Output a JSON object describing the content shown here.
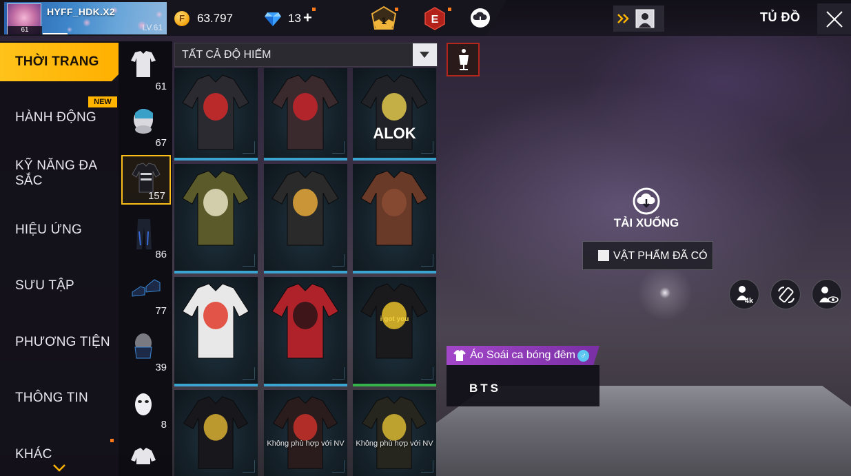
{
  "player": {
    "name": "HYFF_HDK.X2",
    "avatar_level": "61",
    "level_label": "LV.61"
  },
  "currency": {
    "gold_symbol": "F",
    "gold": "63.797",
    "diamonds": "13",
    "add_symbol": "+"
  },
  "top_icons": {
    "rank_badge": "1",
    "elite_badge": "E"
  },
  "header": {
    "title": "TỦ ĐỒ"
  },
  "sidebar": {
    "items": [
      {
        "label": "THỜI TRANG",
        "active": true
      },
      {
        "label": "HÀNH ĐỘNG"
      },
      {
        "label": "KỸ NĂNG ĐA SẮC"
      },
      {
        "label": "HIỆU ỨNG"
      },
      {
        "label": "SƯU TẬP"
      },
      {
        "label": "PHƯƠNG TIỆN"
      },
      {
        "label": "THÔNG TIN"
      },
      {
        "label": "KHÁC"
      }
    ],
    "new_badge": "NEW"
  },
  "categories": [
    {
      "icon": "outfit-icon",
      "count": "61"
    },
    {
      "icon": "headwear-icon",
      "count": "67"
    },
    {
      "icon": "top-icon",
      "count": "157",
      "active": true
    },
    {
      "icon": "pants-icon",
      "count": "86"
    },
    {
      "icon": "shoes-icon",
      "count": "77"
    },
    {
      "icon": "mask-icon",
      "count": "39"
    },
    {
      "icon": "face-mask-icon",
      "count": "8"
    },
    {
      "icon": "jacket-icon",
      "count": ""
    }
  ],
  "filter": {
    "label": "TẤT CẢ ĐỘ HIẾM"
  },
  "items": [
    {
      "name": "wolf-tee",
      "color": "#2a2a30",
      "accent": "#d42a2a",
      "bar": "blue"
    },
    {
      "name": "red-hooded-top",
      "color": "#3a2a2e",
      "accent": "#c8242a",
      "bar": "blue"
    },
    {
      "name": "alok-tee",
      "color": "#202228",
      "accent": "#e0c84a",
      "bar": "blue",
      "print": "ALOK"
    },
    {
      "name": "camo-jacket",
      "color": "#5b5a2a",
      "accent": "#e8e2c2",
      "bar": "blue"
    },
    {
      "name": "varsity-jacket",
      "color": "#2a2a2a",
      "accent": "#e6a83a",
      "bar": "blue"
    },
    {
      "name": "brown-leather-top",
      "color": "#6a3a28",
      "accent": "#8a4c34",
      "bar": "blue"
    },
    {
      "name": "egg-tee",
      "color": "#e8e8e8",
      "accent": "#e03a2a",
      "bar": "blue"
    },
    {
      "name": "plaid-shirt",
      "color": "#b0222a",
      "accent": "#2a1416",
      "bar": "blue"
    },
    {
      "name": "i-got-you-tank",
      "color": "#1a1a1c",
      "accent": "#e8c02a",
      "bar": "green",
      "print": "i got you"
    },
    {
      "name": "black-gold-suit",
      "color": "#18181c",
      "accent": "#d8b032",
      "bar": "none"
    },
    {
      "name": "red-fur-top",
      "color": "#2a1c1c",
      "accent": "#c8302a",
      "bar": "none",
      "note": "Không phù hợp với NV"
    },
    {
      "name": "yellow-armor-top",
      "color": "#26261e",
      "accent": "#d8b832",
      "bar": "none",
      "note": "Không phù hợp với NV"
    }
  ],
  "preview": {
    "download_label": "TẢI XUỐNG",
    "owned_label": "VẬT PHẨM ĐÃ CÓ",
    "res_label": "4k"
  },
  "selected_item": {
    "name": "Áo Soái ca bóng đêm",
    "gender_symbol": "♂",
    "description": "BTS"
  }
}
